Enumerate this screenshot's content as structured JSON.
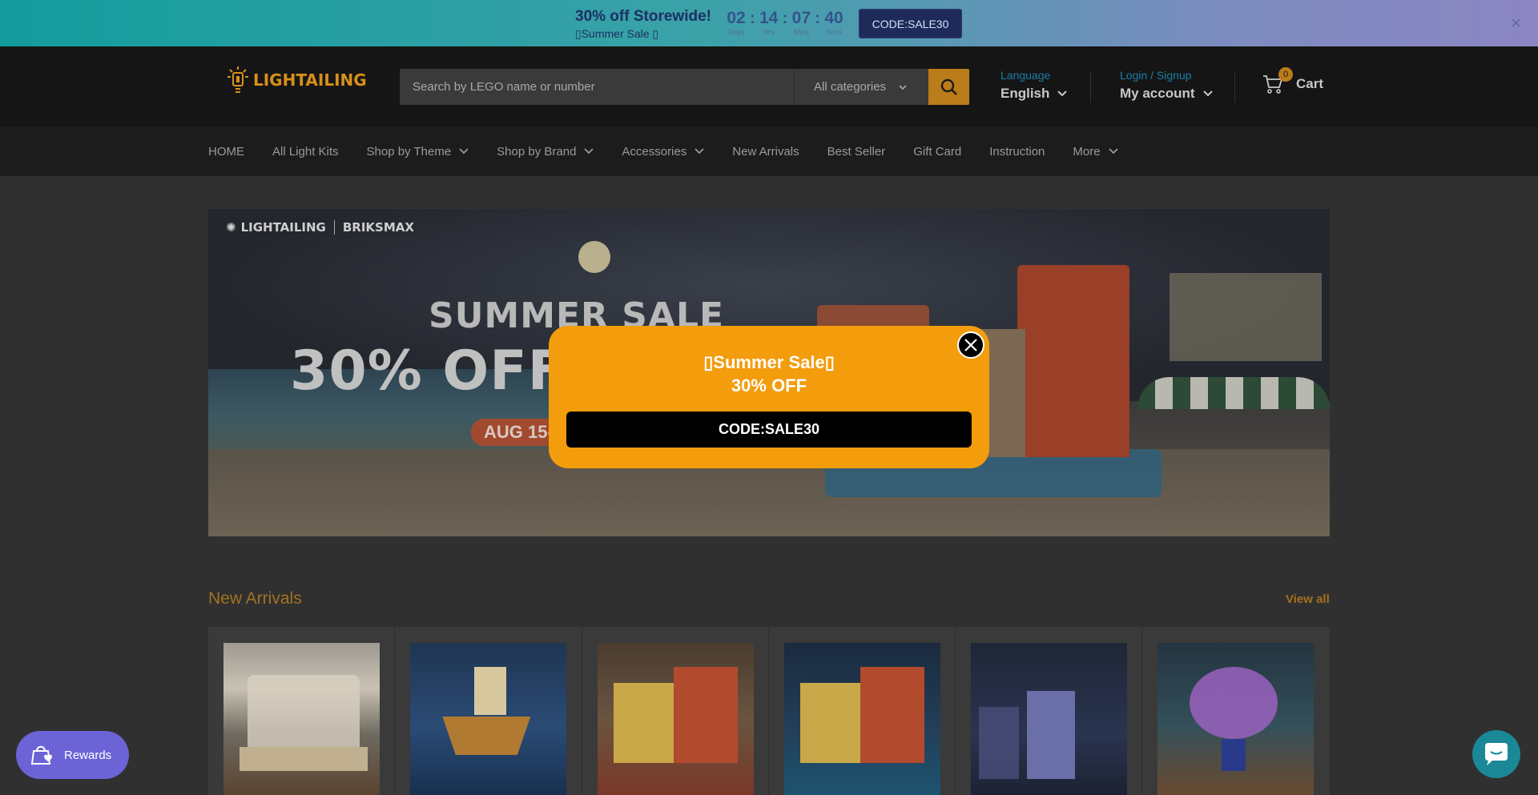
{
  "announcement": {
    "title": "30% off Storewide!",
    "subtitle": "Summer Sale",
    "countdown": [
      {
        "value": "02",
        "label": "Days"
      },
      {
        "value": "14",
        "label": "Hrs"
      },
      {
        "value": "07",
        "label": "Mins"
      },
      {
        "value": "40",
        "label": "Secs"
      }
    ],
    "code_button": "CODE:SALE30",
    "close_symbol": "×"
  },
  "header": {
    "logo_text": "LIGHTAILING",
    "search_placeholder": "Search by LEGO name or number",
    "category_select": "All categories",
    "language_label": "Language",
    "language_value": "English",
    "account_label": "Login / Signup",
    "account_value": "My account",
    "cart_count": "0",
    "cart_label": "Cart"
  },
  "nav": {
    "items": [
      {
        "label": "HOME",
        "dropdown": false
      },
      {
        "label": "All Light Kits",
        "dropdown": false
      },
      {
        "label": "Shop by Theme",
        "dropdown": true
      },
      {
        "label": "Shop by Brand",
        "dropdown": true
      },
      {
        "label": "Accessories",
        "dropdown": true
      },
      {
        "label": "New Arrivals",
        "dropdown": false
      },
      {
        "label": "Best Seller",
        "dropdown": false
      },
      {
        "label": "Gift Card",
        "dropdown": false
      },
      {
        "label": "Instruction",
        "dropdown": false
      },
      {
        "label": "More",
        "dropdown": true
      }
    ]
  },
  "hero": {
    "brand_left": "LIGHTAILING",
    "brand_right": "BRIKSMAX",
    "title_line1": "SUMMER SALE",
    "title_line2": "30% OFF ST",
    "date_pill": "AUG 15-"
  },
  "section": {
    "title": "New Arrivals",
    "view_all": "View all"
  },
  "popup": {
    "line1": "Summer Sale",
    "line2": "30% OFF",
    "code": "CODE:SALE30"
  },
  "rewards": {
    "label": "Rewards"
  },
  "colors": {
    "accent": "#bb7d19",
    "popup": "#f39c0c",
    "rewards": "#6b63d6",
    "chat": "#1a8896",
    "link": "#1a7fa8"
  }
}
